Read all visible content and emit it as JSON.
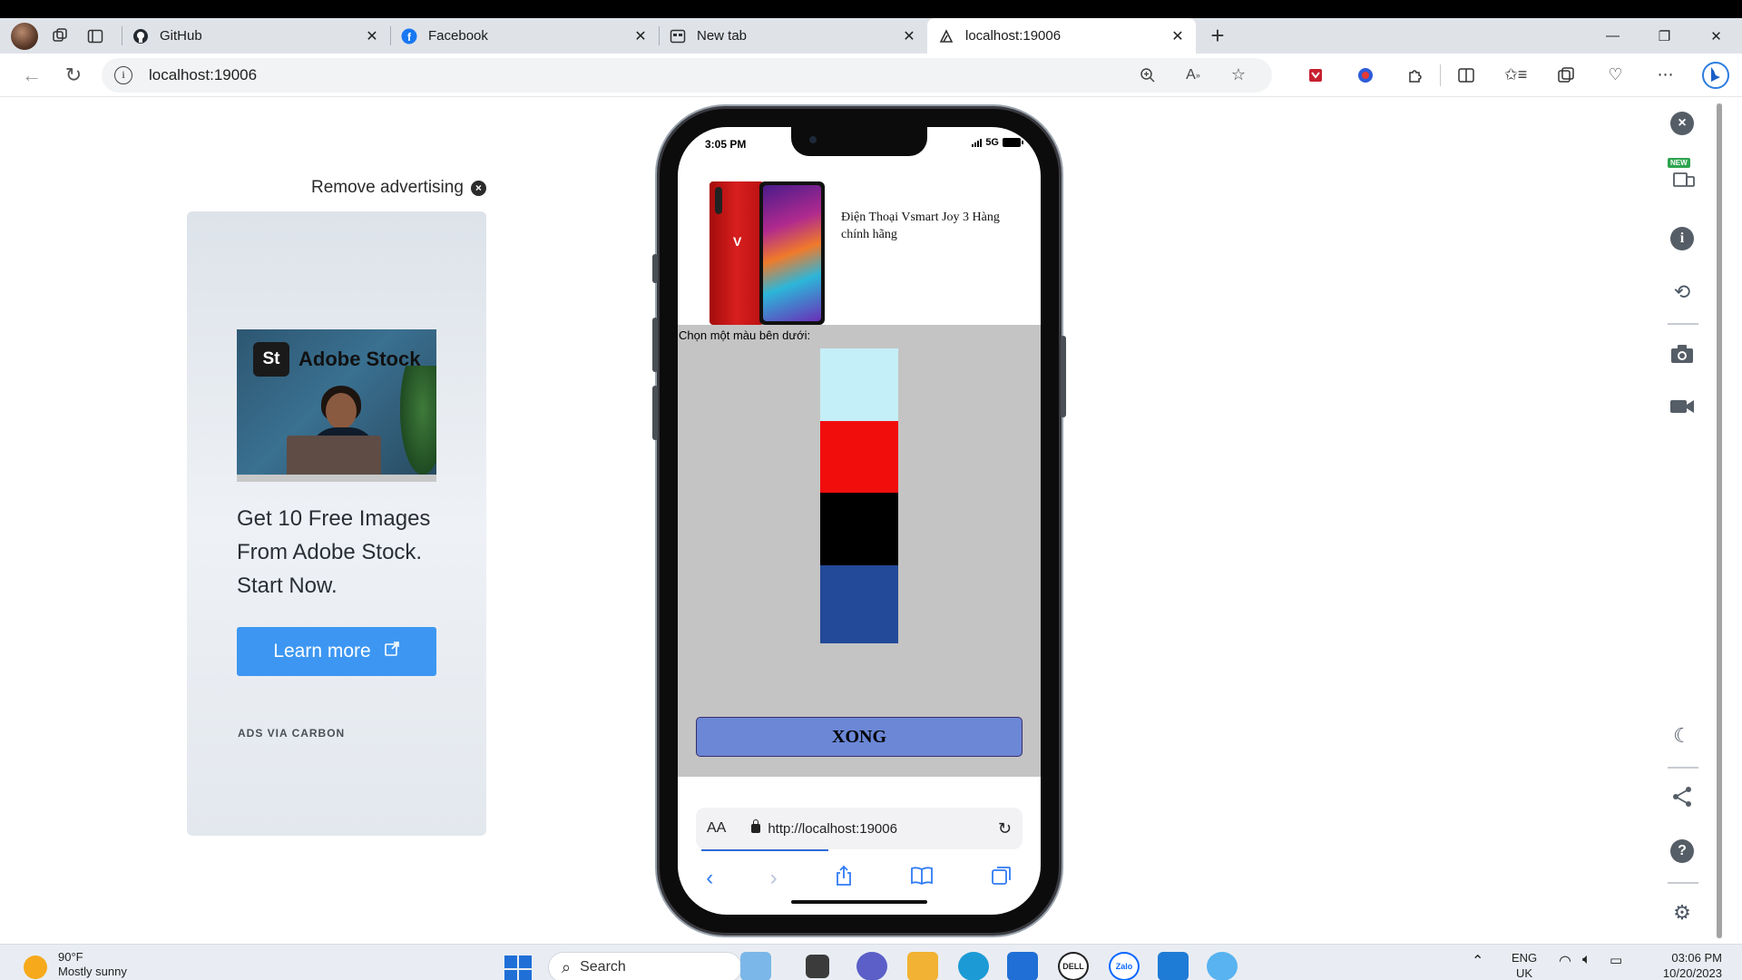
{
  "browser": {
    "tabs": [
      {
        "title": "GitHub",
        "icon": "github-icon",
        "active": false
      },
      {
        "title": "Facebook",
        "icon": "facebook-icon",
        "active": false
      },
      {
        "title": "New tab",
        "icon": "newtab-icon",
        "active": false
      },
      {
        "title": "localhost:19006",
        "icon": "expo-icon",
        "active": true
      }
    ],
    "address": "localhost:19006"
  },
  "ad": {
    "remove_label": "Remove advertising",
    "brand": "Adobe Stock",
    "brand_badge": "St",
    "headline": "Get 10 Free Images From Adobe Stock. Start Now.",
    "button_label": "Learn more",
    "via": "ADS VIA CARBON"
  },
  "phone": {
    "time": "3:05 PM",
    "network": "5G",
    "product_name": "Điện Thoại Vsmart Joy 3 Hàng chính hãng",
    "color_prompt": "Chọn một màu bên dưới:",
    "swatches": [
      "#c5eff8",
      "#f20d0d",
      "#000000",
      "#234a99"
    ],
    "done_label": "XONG",
    "safari_aa": "AA",
    "safari_url": "http://localhost:19006"
  },
  "taskbar": {
    "weather_temp": "90°F",
    "weather_desc": "Mostly sunny",
    "search_label": "Search",
    "lang": "ENG",
    "lang_region": "UK",
    "time": "03:06 PM",
    "date": "10/20/2023"
  },
  "colors": {
    "accent_blue": "#3d97f2",
    "done_button": "#6b87d6",
    "color_panel": "#c4c4c4"
  }
}
